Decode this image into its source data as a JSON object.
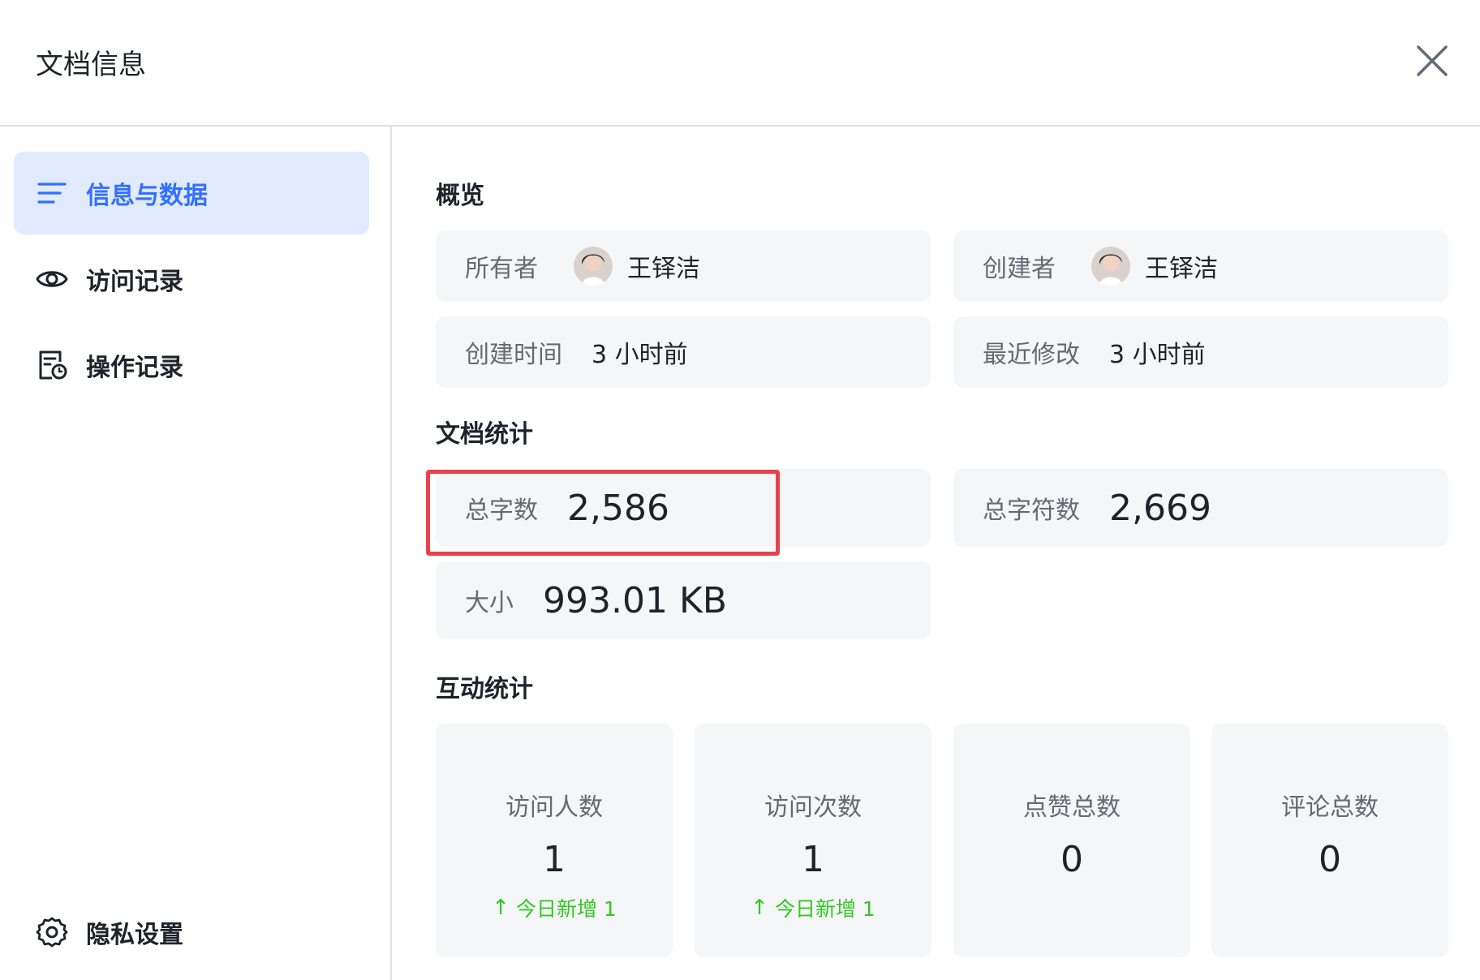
{
  "header": {
    "title": "文档信息",
    "close_icon": "close-icon"
  },
  "sidebar": {
    "items": [
      {
        "label": "信息与数据",
        "icon": "list-icon",
        "active": true
      },
      {
        "label": "访问记录",
        "icon": "eye-icon",
        "active": false
      },
      {
        "label": "操作记录",
        "icon": "document-clock-icon",
        "active": false
      }
    ],
    "footer_item": {
      "label": "隐私设置",
      "icon": "gear-icon"
    }
  },
  "overview": {
    "title": "概览",
    "owner": {
      "label": "所有者",
      "name": "王铎洁"
    },
    "creator": {
      "label": "创建者",
      "name": "王铎洁"
    },
    "created_time": {
      "label": "创建时间",
      "value": "3 小时前"
    },
    "modified_time": {
      "label": "最近修改",
      "value": "3 小时前"
    }
  },
  "doc_stats": {
    "title": "文档统计",
    "word_count": {
      "label": "总字数",
      "value": "2,586"
    },
    "char_count": {
      "label": "总字符数",
      "value": "2,669"
    },
    "size": {
      "label": "大小",
      "value": "993.01 KB"
    }
  },
  "interaction_stats": {
    "title": "互动统计",
    "items": [
      {
        "label": "访问人数",
        "value": "1",
        "delta": "今日新增 1"
      },
      {
        "label": "访问次数",
        "value": "1",
        "delta": "今日新增 1"
      },
      {
        "label": "点赞总数",
        "value": "0"
      },
      {
        "label": "评论总数",
        "value": "0"
      }
    ]
  },
  "colors": {
    "accent": "#3370ff",
    "active_bg": "#e1eaff",
    "card_bg": "#f5f6f7",
    "highlight": "#e8434a",
    "positive": "#34c724"
  }
}
